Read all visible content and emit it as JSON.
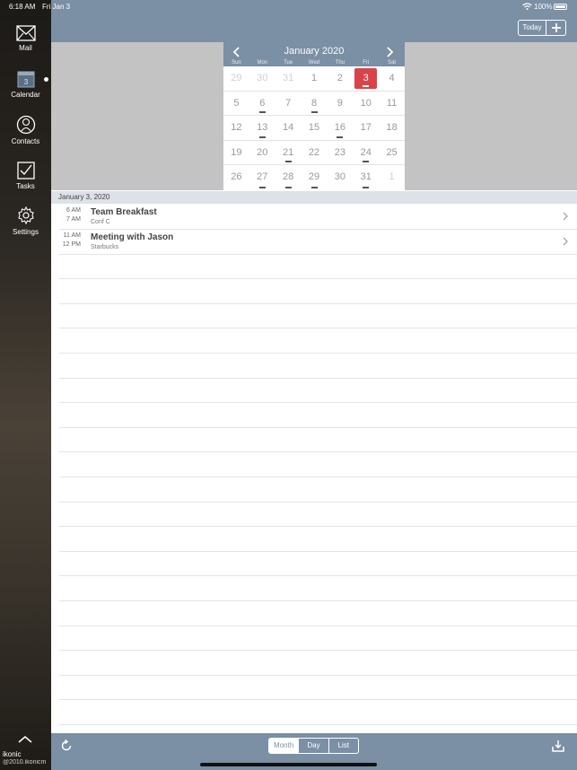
{
  "status": {
    "time": "6:18 AM",
    "date": "Fri Jan 3",
    "battery": "100%"
  },
  "sidebar": {
    "items": [
      {
        "label": "Mail",
        "icon": "mail-icon"
      },
      {
        "label": "Calendar",
        "icon": "calendar-icon",
        "badge": "3"
      },
      {
        "label": "Contacts",
        "icon": "contacts-icon"
      },
      {
        "label": "Tasks",
        "icon": "tasks-icon"
      },
      {
        "label": "Settings",
        "icon": "settings-icon"
      }
    ],
    "brand": "ikonic",
    "copyright": "@2010.ikonicm"
  },
  "header": {
    "today_label": "Today"
  },
  "calendar": {
    "title": "January 2020",
    "weekdays": [
      "Sun",
      "Mon",
      "Tue",
      "Wed",
      "Thu",
      "Fri",
      "Sat"
    ],
    "weeks": [
      [
        {
          "d": "29",
          "o": true
        },
        {
          "d": "30",
          "o": true
        },
        {
          "d": "31",
          "o": true
        },
        {
          "d": "1"
        },
        {
          "d": "2"
        },
        {
          "d": "3",
          "sel": true,
          "ev": true
        },
        {
          "d": "4"
        }
      ],
      [
        {
          "d": "5"
        },
        {
          "d": "6",
          "ev": true
        },
        {
          "d": "7"
        },
        {
          "d": "8",
          "ev": true
        },
        {
          "d": "9"
        },
        {
          "d": "10"
        },
        {
          "d": "11"
        }
      ],
      [
        {
          "d": "12"
        },
        {
          "d": "13",
          "ev": true
        },
        {
          "d": "14"
        },
        {
          "d": "15"
        },
        {
          "d": "16",
          "ev": true
        },
        {
          "d": "17"
        },
        {
          "d": "18"
        }
      ],
      [
        {
          "d": "19"
        },
        {
          "d": "20"
        },
        {
          "d": "21",
          "ev": true
        },
        {
          "d": "22"
        },
        {
          "d": "23"
        },
        {
          "d": "24",
          "ev": true
        },
        {
          "d": "25"
        }
      ],
      [
        {
          "d": "26"
        },
        {
          "d": "27",
          "ev": true
        },
        {
          "d": "28",
          "ev": true
        },
        {
          "d": "29",
          "ev": true
        },
        {
          "d": "30"
        },
        {
          "d": "31",
          "ev": true
        },
        {
          "d": "1",
          "o": true
        }
      ]
    ]
  },
  "list": {
    "date_header": "January 3, 2020",
    "events": [
      {
        "start": "6 AM",
        "end": "7 AM",
        "title": "Team Breakfast",
        "location": "Conf C"
      },
      {
        "start": "11 AM",
        "end": "12 PM",
        "title": "Meeting with Jason",
        "location": "Starbucks"
      }
    ]
  },
  "toolbar": {
    "views": [
      {
        "label": "Month",
        "active": true
      },
      {
        "label": "Day"
      },
      {
        "label": "List"
      }
    ]
  },
  "colors": {
    "accent": "#7b8fa5",
    "selected": "#d9434a"
  }
}
